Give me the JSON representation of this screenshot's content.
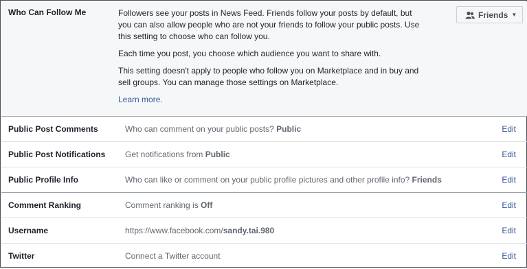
{
  "follow_section": {
    "label": "Who Can Follow Me",
    "paragraphs": [
      "Followers see your posts in News Feed. Friends follow your posts by default, but you can also allow people who are not your friends to follow your public posts. Use this setting to choose who can follow you.",
      "Each time you post, you choose which audience you want to share with.",
      "This setting doesn't apply to people who follow you on Marketplace and in buy and sell groups. You can manage those settings on Marketplace."
    ],
    "learn_more": "Learn more.",
    "audience_button": {
      "label": "Friends",
      "icon": "friends-icon",
      "caret": "▼"
    }
  },
  "rows": [
    {
      "label": "Public Post Comments",
      "prefix": "Who can comment on your public posts? ",
      "value": "Public",
      "suffix": "",
      "edit": "Edit"
    },
    {
      "label": "Public Post Notifications",
      "prefix": "Get notifications from ",
      "value": "Public",
      "suffix": "",
      "edit": "Edit"
    },
    {
      "label": "Public Profile Info",
      "prefix": "Who can like or comment on your public profile pictures and other profile info? ",
      "value": "Friends",
      "suffix": "",
      "edit": "Edit"
    },
    {
      "label": "Comment Ranking",
      "prefix": "Comment ranking is ",
      "value": "Off",
      "suffix": "",
      "edit": "Edit"
    },
    {
      "label": "Username",
      "prefix": "https://www.facebook.com/",
      "value": "sandy.tai.980",
      "suffix": "",
      "edit": "Edit"
    },
    {
      "label": "Twitter",
      "prefix": "Connect a Twitter account",
      "value": "",
      "suffix": "",
      "edit": "Edit"
    }
  ],
  "colors": {
    "link": "#365899",
    "muted_text": "#606770",
    "section_bg": "#f6f7f9"
  }
}
